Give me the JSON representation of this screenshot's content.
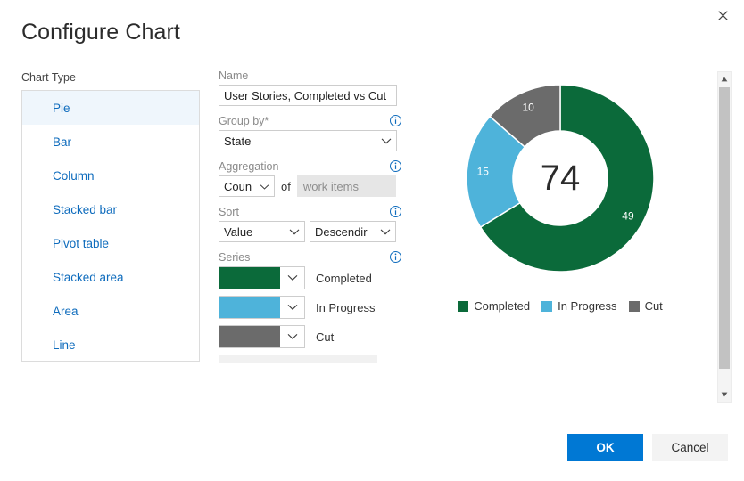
{
  "dialog": {
    "title": "Configure Chart",
    "close_icon": "close-icon"
  },
  "chart_type": {
    "label": "Chart Type",
    "selected": "Pie",
    "items": [
      {
        "label": "Pie"
      },
      {
        "label": "Bar"
      },
      {
        "label": "Column"
      },
      {
        "label": "Stacked bar"
      },
      {
        "label": "Pivot table"
      },
      {
        "label": "Stacked area"
      },
      {
        "label": "Area"
      },
      {
        "label": "Line"
      }
    ]
  },
  "form": {
    "name": {
      "label": "Name",
      "value": "User Stories, Completed vs Cut"
    },
    "group_by": {
      "label": "Group by*",
      "value": "State",
      "info_icon": "info-icon"
    },
    "aggregation": {
      "label": "Aggregation",
      "function_value": "Coun",
      "of_text": "of",
      "field_value": "work items",
      "info_icon": "info-icon"
    },
    "sort": {
      "label": "Sort",
      "by_value": "Value",
      "direction_value": "Descendir",
      "info_icon": "info-icon"
    },
    "series": {
      "label": "Series",
      "info_icon": "info-icon",
      "items": [
        {
          "name": "Completed",
          "color": "#0b6a3a"
        },
        {
          "name": "In Progress",
          "color": "#4eb3da"
        },
        {
          "name": "Cut",
          "color": "#6b6b6b"
        }
      ]
    }
  },
  "chart_data": {
    "type": "pie",
    "title": "User Stories, Completed vs Cut",
    "variant": "donut",
    "center_label": "74",
    "total": 74,
    "categories": [
      "Completed",
      "In Progress",
      "Cut"
    ],
    "values": [
      49,
      15,
      10
    ],
    "colors": [
      "#0b6a3a",
      "#4eb3da",
      "#6b6b6b"
    ],
    "data_labels": [
      "49",
      "15",
      "10"
    ],
    "legend": {
      "position": "bottom",
      "entries": [
        {
          "label": "Completed",
          "color": "#0b6a3a"
        },
        {
          "label": "In Progress",
          "color": "#4eb3da"
        },
        {
          "label": "Cut",
          "color": "#6b6b6b"
        }
      ]
    }
  },
  "scrollbar": {
    "up_icon": "scroll-up-arrow-icon",
    "down_icon": "scroll-down-arrow-icon"
  },
  "footer": {
    "ok_label": "OK",
    "cancel_label": "Cancel",
    "ok_color": "#0078d4"
  }
}
